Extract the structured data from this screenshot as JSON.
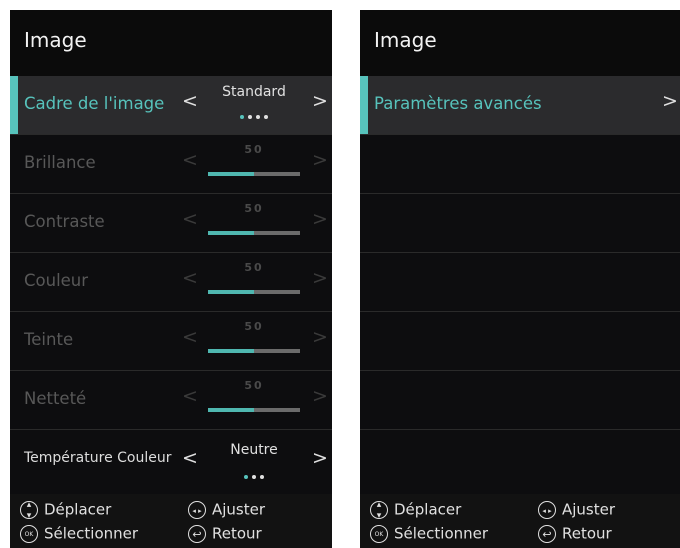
{
  "left_panel": {
    "title": "Image",
    "rows": [
      {
        "label": "Cadre de l'image",
        "value": "Standard",
        "dots": 4,
        "active_dot": 0
      },
      {
        "label": "Brillance",
        "value": "50",
        "level": 0.5
      },
      {
        "label": "Contraste",
        "value": "50",
        "level": 0.5
      },
      {
        "label": "Couleur",
        "value": "50",
        "level": 0.5
      },
      {
        "label": "Teinte",
        "value": "50",
        "level": 0.5
      },
      {
        "label": "Netteté",
        "value": "50",
        "level": 0.5
      },
      {
        "label": "Température Couleur",
        "value": "Neutre",
        "dots": 3,
        "active_dot": 0
      }
    ],
    "footer": {
      "move": "Déplacer",
      "adjust": "Ajuster",
      "select": "Sélectionner",
      "back": "Retour"
    }
  },
  "right_panel": {
    "title": "Image",
    "rows": [
      {
        "label": "Paramètres avancés"
      }
    ],
    "footer": {
      "move": "Déplacer",
      "adjust": "Ajuster",
      "select": "Sélectionner",
      "back": "Retour"
    }
  },
  "colors": {
    "accent": "#57c3bc",
    "background": "#0d0d0f",
    "selected_row": "#2b2b2d"
  },
  "icons": {
    "left_chevron": "‹",
    "right_chevron": "›"
  }
}
